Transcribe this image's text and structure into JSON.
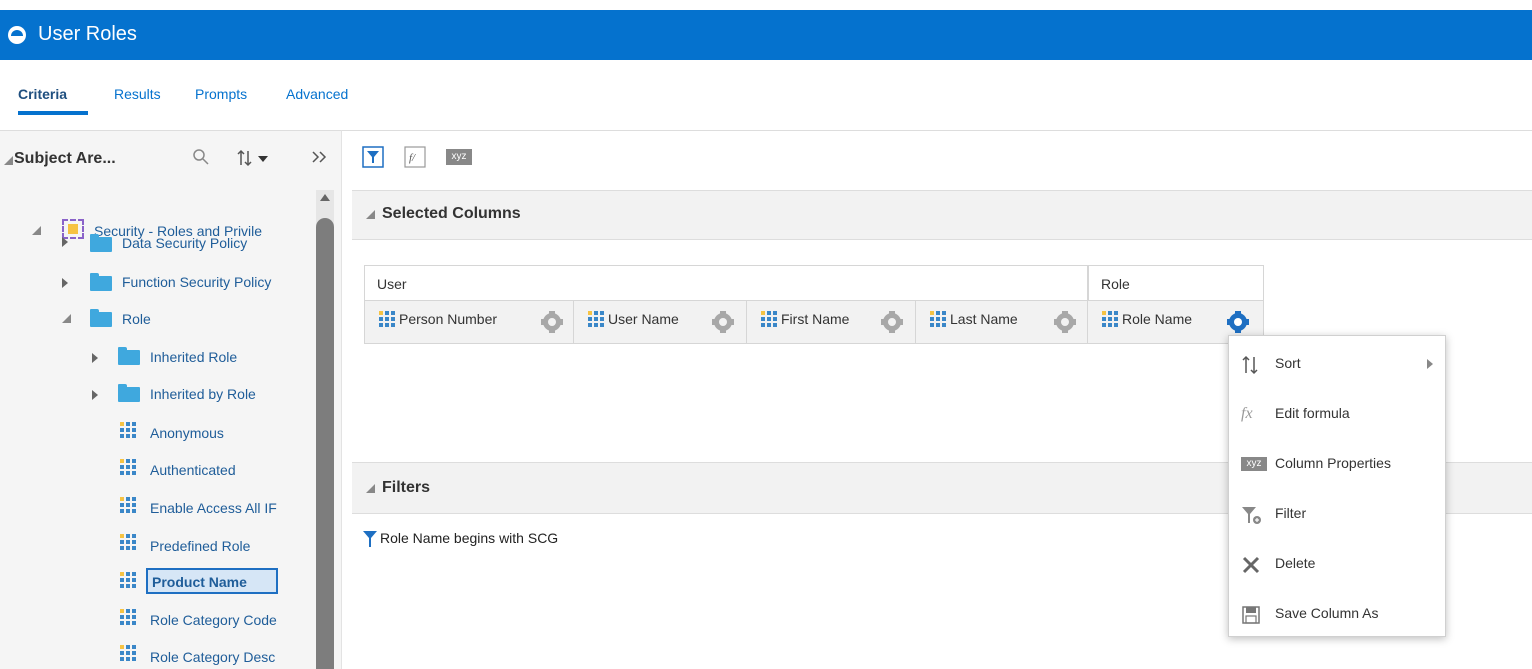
{
  "app": {
    "title": "User Roles",
    "accent_color": "#0572ce"
  },
  "tabs": [
    {
      "label": "Criteria",
      "active": true
    },
    {
      "label": "Results",
      "active": false
    },
    {
      "label": "Prompts",
      "active": false
    },
    {
      "label": "Advanced",
      "active": false
    }
  ],
  "left_pane": {
    "header": "Subject Are...",
    "icons": [
      "collapse-triangle-icon",
      "search-icon",
      "sort-icon",
      "collapse-pane-icon"
    ],
    "tree": [
      {
        "label": "Security - Roles and Privile",
        "type": "subject-area",
        "expanded": true
      },
      {
        "label": "Data Security Policy",
        "type": "folder",
        "expanded": false
      },
      {
        "label": "Function Security Policy",
        "type": "folder",
        "expanded": false
      },
      {
        "label": "Role",
        "type": "folder",
        "expanded": true
      },
      {
        "label": "Inherited Role",
        "type": "folder",
        "expanded": false
      },
      {
        "label": "Inherited by Role",
        "type": "folder",
        "expanded": false
      },
      {
        "label": "Anonymous",
        "type": "column"
      },
      {
        "label": "Authenticated",
        "type": "column"
      },
      {
        "label": "Enable Access All IF",
        "type": "column"
      },
      {
        "label": "Predefined Role",
        "type": "column"
      },
      {
        "label": "Product Name",
        "type": "column",
        "selected": true
      },
      {
        "label": "Role Category Code",
        "type": "column"
      },
      {
        "label": "Role Category Desc",
        "type": "column"
      }
    ]
  },
  "toolbar": {
    "icons": [
      "filter-icon",
      "edit-formula-icon",
      "column-properties-icon"
    ],
    "xyz_label": "xyz"
  },
  "selected_columns": {
    "title": "Selected Columns",
    "groups": [
      {
        "label": "User"
      },
      {
        "label": "Role"
      }
    ],
    "columns": [
      {
        "label": "Person Number",
        "group": "User"
      },
      {
        "label": "User Name",
        "group": "User"
      },
      {
        "label": "First Name",
        "group": "User"
      },
      {
        "label": "Last Name",
        "group": "User"
      },
      {
        "label": "Role Name",
        "group": "Role",
        "menu_open": true
      }
    ]
  },
  "filters": {
    "title": "Filters",
    "items": [
      {
        "column": "Role Name",
        "condition": "begins with SCG"
      }
    ]
  },
  "context_menu": {
    "items": [
      {
        "label": "Sort",
        "icon": "sort-icon",
        "submenu": true
      },
      {
        "label": "Edit formula",
        "icon": "fx-icon"
      },
      {
        "label": "Column Properties",
        "icon": "xyz-icon"
      },
      {
        "label": "Filter",
        "icon": "filter-add-icon"
      },
      {
        "label": "Delete",
        "icon": "delete-x-icon"
      },
      {
        "label": "Save Column As",
        "icon": "save-icon"
      }
    ],
    "fx_glyph": "fx",
    "xyz_glyph": "xyz"
  }
}
